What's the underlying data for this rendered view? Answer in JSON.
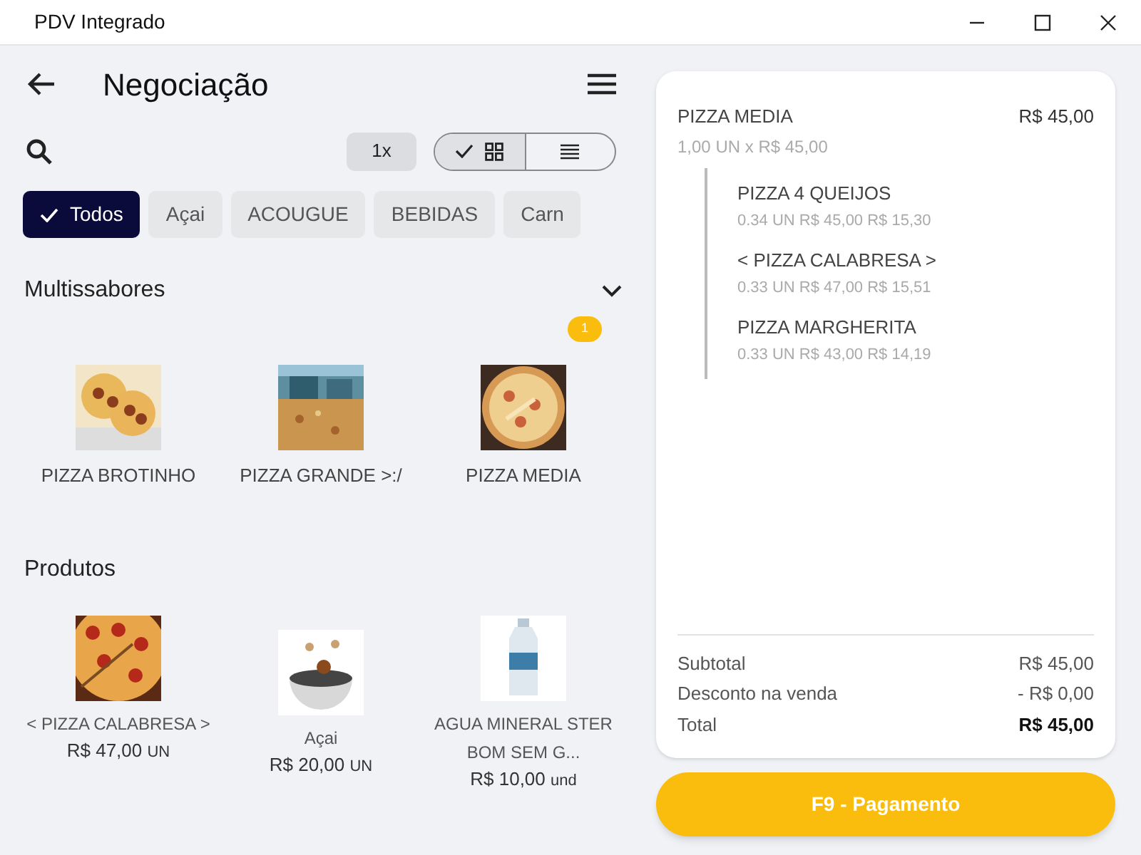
{
  "window": {
    "title": "PDV Integrado"
  },
  "header": {
    "title": "Negociação"
  },
  "toolbar": {
    "quantity": "1x",
    "view_modes": [
      {
        "kind": "grid",
        "selected": true
      },
      {
        "kind": "list",
        "selected": false
      }
    ]
  },
  "categories": [
    {
      "label": "Todos",
      "selected": true
    },
    {
      "label": "Açai",
      "selected": false
    },
    {
      "label": "ACOUGUE",
      "selected": false
    },
    {
      "label": "BEBIDAS",
      "selected": false
    },
    {
      "label": "Carn",
      "selected": false
    }
  ],
  "multiflavor": {
    "title": "Multissabores",
    "expanded": true,
    "items": [
      {
        "name": "PIZZA BROTINHO"
      },
      {
        "name": "PIZZA GRANDE >:/"
      },
      {
        "name": "PIZZA MEDIA",
        "badge": "1"
      }
    ]
  },
  "products": {
    "title": "Produtos",
    "items": [
      {
        "name": "< PIZZA CALABRESA >",
        "price": "R$ 47,00",
        "unit": "UN"
      },
      {
        "name": "Açai",
        "price": "R$ 20,00",
        "unit": "UN"
      },
      {
        "name": "AGUA MINERAL STER BOM SEM G...",
        "price": "R$ 10,00",
        "unit": "und"
      }
    ]
  },
  "order": {
    "items": [
      {
        "name": "PIZZA MEDIA",
        "total": "R$ 45,00",
        "detail": "1,00 UN x R$ 45,00",
        "flavors": [
          {
            "name": "PIZZA 4 QUEIJOS",
            "detail": "0.34 UN R$ 45,00 R$ 15,30"
          },
          {
            "name": "< PIZZA CALABRESA >",
            "detail": "0.33 UN R$ 47,00 R$ 15,51"
          },
          {
            "name": "PIZZA MARGHERITA",
            "detail": "0.33 UN R$ 43,00 R$ 14,19"
          }
        ]
      }
    ],
    "summary": [
      {
        "label": "Subtotal",
        "value": "R$ 45,00",
        "emphasis": false
      },
      {
        "label": "Desconto na venda",
        "value": "- R$ 0,00",
        "emphasis": false
      },
      {
        "label": "Total",
        "value": "R$ 45,00",
        "emphasis": true
      }
    ]
  },
  "pay_button": "F9 - Pagamento"
}
